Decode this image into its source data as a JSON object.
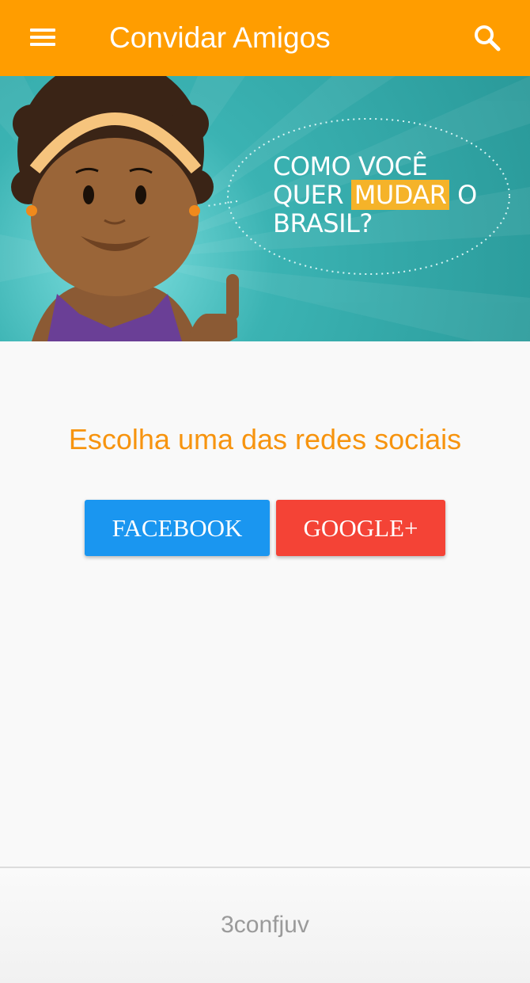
{
  "appbar": {
    "title": "Convidar Amigos",
    "menu_icon": "menu-icon",
    "search_icon": "search-icon",
    "color": "#ff9d00"
  },
  "banner": {
    "line1": "COMO VOCÊ",
    "line2_prefix": "QUER",
    "line2_highlight": "MUDAR",
    "line2_suffix": "O",
    "line3": "BRASIL?",
    "background_color": "#2aa3a3",
    "highlight_color": "#f5b329"
  },
  "main": {
    "heading": "Escolha uma das redes sociais",
    "buttons": {
      "facebook": "FACEBOOK",
      "google": "GOOGLE+"
    },
    "facebook_color": "#1a96f0",
    "google_color": "#f44336",
    "heading_color": "#f7940f"
  },
  "footer": {
    "text": "3confjuv"
  }
}
